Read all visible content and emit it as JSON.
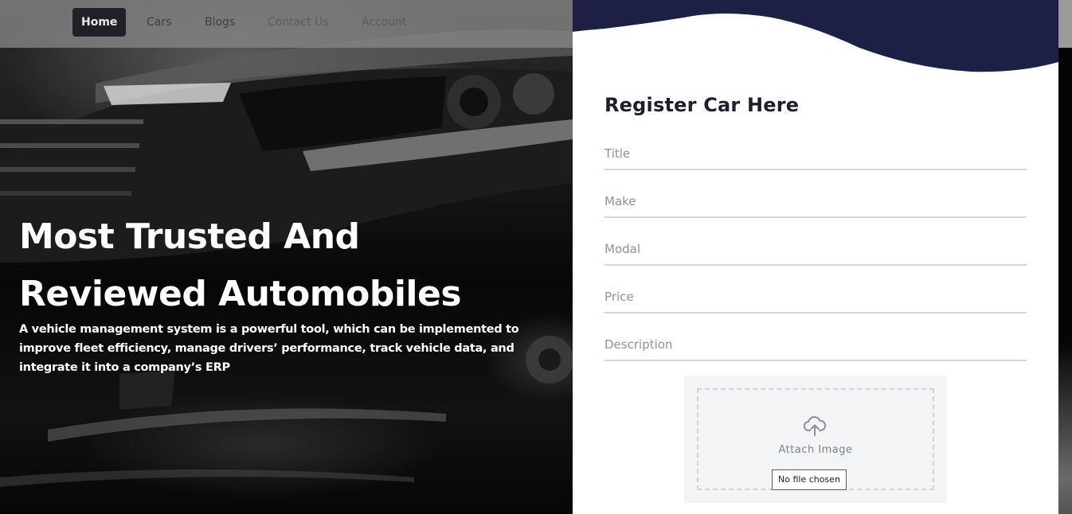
{
  "nav": {
    "items": [
      {
        "label": "Home"
      },
      {
        "label": "Cars"
      },
      {
        "label": "Blogs"
      },
      {
        "label": "Contact Us"
      },
      {
        "label": "Account"
      }
    ]
  },
  "hero": {
    "title_line1": "Most Trusted And",
    "title_line2": "Reviewed Automobiles",
    "description": "A vehicle management system is a powerful tool, which can be implemented to improve fleet efficiency, manage drivers’ performance, track vehicle data, and integrate it into a company’s ERP"
  },
  "form": {
    "title": "Register Car Here",
    "fields": {
      "title_placeholder": "Title",
      "make_placeholder": "Make",
      "modal_placeholder": "Modal",
      "price_placeholder": "Price",
      "description_placeholder": "Description"
    },
    "upload": {
      "icon": "cloud-upload-icon",
      "label": "Attach Image",
      "file_status": "No file chosen"
    }
  },
  "colors": {
    "navy_wave": "#1e1f45",
    "active_nav": "#1f2127",
    "title_text": "#1d1f2c",
    "field_line": "#d3d5da",
    "placeholder": "#8d93a0"
  }
}
